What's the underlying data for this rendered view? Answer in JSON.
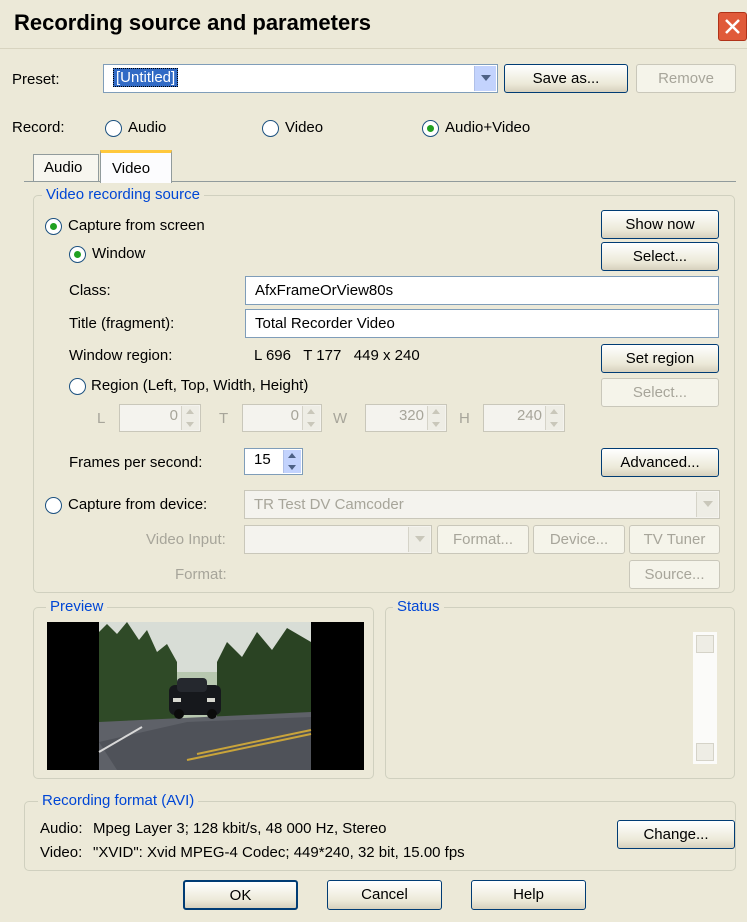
{
  "window": {
    "title": "Recording source and parameters"
  },
  "preset": {
    "label": "Preset:",
    "value": "[Untitled]",
    "save_as": "Save as...",
    "remove": "Remove"
  },
  "record": {
    "label": "Record:",
    "options": [
      "Audio",
      "Video",
      "Audio+Video"
    ],
    "selected": "Audio+Video"
  },
  "tabs": [
    "Audio",
    "Video"
  ],
  "active_tab": "Video",
  "video_source": {
    "group_title": "Video recording source",
    "capture_screen": "Capture from screen",
    "show_now": "Show now",
    "window_label": "Window",
    "select": "Select...",
    "class_label": "Class:",
    "class_value": "AfxFrameOrView80s",
    "title_label": "Title (fragment):",
    "title_value": "Total Recorder Video",
    "region_label": "Window region:",
    "region_value": "L 696   T 177   449 x 240",
    "set_region": "Set region",
    "region_radio": "Region (Left, Top, Width, Height)",
    "region_select": "Select...",
    "l_label": "L",
    "l_value": "0",
    "t_label": "T",
    "t_value": "0",
    "w_label": "W",
    "w_value": "320",
    "h_label": "H",
    "h_value": "240",
    "fps_label": "Frames per second:",
    "fps_value": "15",
    "advanced": "Advanced...",
    "capture_device": "Capture from device:",
    "device_value": "TR Test DV Camcoder",
    "video_input_label": "Video Input:",
    "format_btn": "Format...",
    "device_btn": "Device...",
    "tv_tuner": "TV Tuner",
    "format_label": "Format:",
    "source_btn": "Source..."
  },
  "preview": {
    "title": "Preview"
  },
  "status": {
    "title": "Status"
  },
  "recording_format": {
    "title": "Recording format (AVI)",
    "audio_label": "Audio:",
    "audio_value": "Mpeg Layer 3; 128 kbit/s, 48 000 Hz, Stereo",
    "video_label": "Video:",
    "video_value": "\"XVID\": Xvid MPEG-4 Codec; 449*240, 32 bit, 15.00 fps",
    "change": "Change..."
  },
  "footer": {
    "ok": "OK",
    "cancel": "Cancel",
    "help": "Help"
  },
  "colors": {
    "dialog_bg": "#ece9d8",
    "group_title": "#0046d5",
    "radio_dot": "#21a121",
    "button_border": "#003c74"
  }
}
